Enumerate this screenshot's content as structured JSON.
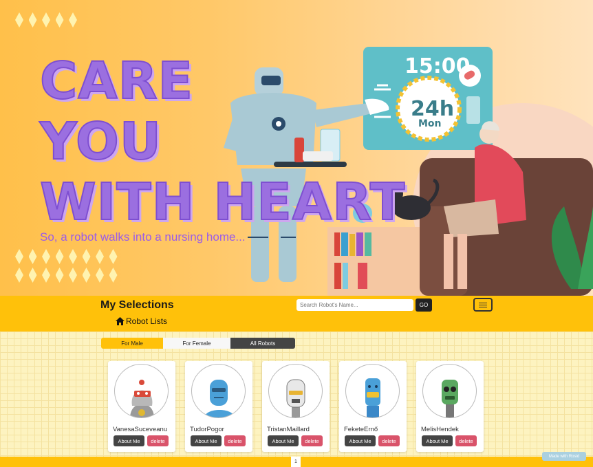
{
  "hero": {
    "title_lines": [
      "CARE",
      "YOU",
      "WITH HEART"
    ],
    "subtitle": "So, a robot walks into a nursing home...",
    "clock_time": "15:00",
    "clock_label_main": "24h",
    "clock_label_day": "Mon"
  },
  "nav": {
    "brand": "My Selections",
    "robot_lists": "Robot Lists",
    "search_placeholder": "Search Robot's Name...",
    "go_label": "GO"
  },
  "tabs": [
    "For Male",
    "For Female",
    "All Robots"
  ],
  "robots": [
    {
      "name": "VanesaSuceveanu",
      "about": "About Me",
      "delete": "delete"
    },
    {
      "name": "TudorPogor",
      "about": "About Me",
      "delete": "delete"
    },
    {
      "name": "TristanMaillard",
      "about": "About Me",
      "delete": "delete"
    },
    {
      "name": "FeketeErnő",
      "about": "About Me",
      "delete": "delete"
    },
    {
      "name": "MelisHendek",
      "about": "About Me",
      "delete": "delete"
    }
  ],
  "pagination": {
    "current": "1"
  },
  "badge": "Made with Rosid",
  "colors": {
    "accent": "#ffc10a",
    "delete": "#d9536a",
    "dark": "#444444",
    "title": "#9b6fe0"
  }
}
